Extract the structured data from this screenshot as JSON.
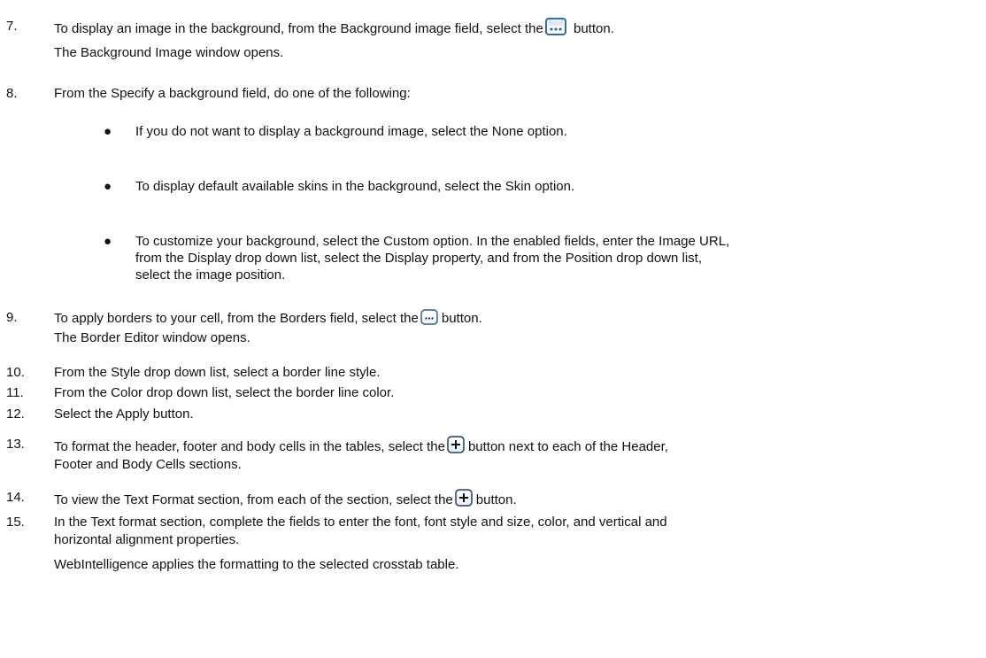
{
  "steps": {
    "s7": {
      "num": "7.",
      "text_a": "To display an image in the background, from the Background image field, select the",
      "text_b": "button.",
      "result": "The Background Image window opens."
    },
    "s8": {
      "num": "8.",
      "text": "From the Specify a background field, do one of the following:",
      "bullets": [
        "If you do not want to display a background image, select the None option.",
        "To display default available skins in the background, select the Skin option.",
        "To customize your background, select the Custom option. In the enabled fields, enter the Image URL,",
        "from the Display drop down list, select the Display property, and from the Position drop down list,",
        "select the image position."
      ]
    },
    "s9": {
      "num": "9.",
      "text_a": "To apply borders to your cell, from the Borders field, select the",
      "text_b": "button.",
      "result": "The Border Editor window opens."
    },
    "s10": {
      "num": "10.",
      "text": "From the Style drop down list, select a border line style."
    },
    "s11": {
      "num": "11.",
      "text": "From the Color drop down list, select the border line color."
    },
    "s12": {
      "num": "12.",
      "text": "Select the Apply button."
    },
    "s13": {
      "num": "13.",
      "text_a": "To format the header, footer and body cells in the tables, select the",
      "text_b": "button next to each of the Header,",
      "text_c": "Footer and Body Cells sections."
    },
    "s14": {
      "num": "14.",
      "text_a": "To view the Text Format section, from each of the section, select the",
      "text_b": "button."
    },
    "s15": {
      "num": "15.",
      "text_a": "In the Text format section, complete the fields to enter the font, font style and size, color, and vertical and",
      "text_b": "horizontal alignment properties.",
      "result": "WebIntelligence applies the formatting to the selected crosstab table."
    }
  },
  "icons": {
    "ellipsis_blue": "ellipsis-button-icon",
    "ellipsis_small": "ellipsis-small-button-icon",
    "plus": "plus-button-icon"
  }
}
